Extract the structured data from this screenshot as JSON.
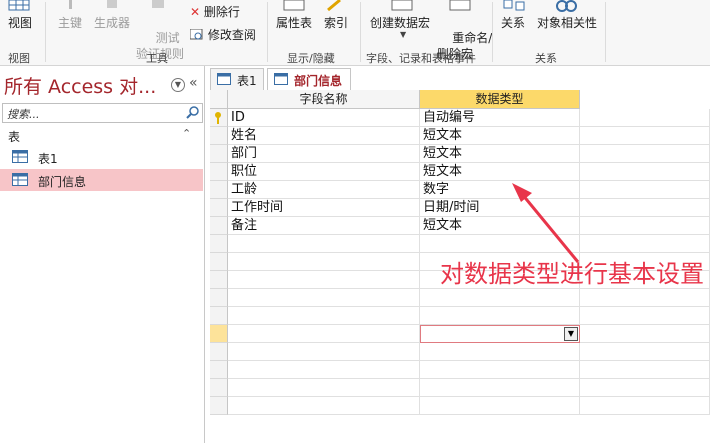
{
  "ribbon": {
    "view_label": "视图",
    "primary_key_label": "主键",
    "builder_label": "生成器",
    "test_rules_label": "测试\n验证规则",
    "delete_rows_label": "删除行",
    "modify_lookups_label": "修改查阅",
    "property_sheet_label": "属性表",
    "indexes_label": "索引",
    "create_macro_label": "创建数据宏",
    "rename_delete_macro_label": "重命名/\n删除宏",
    "relationships_label": "关系",
    "object_dependencies_label": "对象相关性",
    "groups": {
      "views": "视图",
      "tools": "工具",
      "show_hide": "显示/隐藏",
      "field_record_events": "字段、记录和表格事件",
      "relationships": "关系"
    }
  },
  "nav": {
    "title": "所有 Access 对...",
    "search_placeholder": "搜索...",
    "group_label": "表",
    "items": [
      {
        "label": "表1",
        "selected": false
      },
      {
        "label": "部门信息",
        "selected": true
      }
    ]
  },
  "tabs": [
    {
      "label": "表1",
      "active": false
    },
    {
      "label": "部门信息",
      "active": true
    }
  ],
  "grid": {
    "columns": [
      "字段名称",
      "数据类型"
    ],
    "rows": [
      {
        "field": "ID",
        "type": "自动编号",
        "primary_key": true
      },
      {
        "field": "姓名",
        "type": "短文本"
      },
      {
        "field": "部门",
        "type": "短文本"
      },
      {
        "field": "职位",
        "type": "短文本"
      },
      {
        "field": "工龄",
        "type": "数字"
      },
      {
        "field": "工作时间",
        "type": "日期/时间"
      },
      {
        "field": "备注",
        "type": "短文本"
      }
    ]
  },
  "annotation": "对数据类型进行基本设置",
  "colors": {
    "accent": "#a4262c",
    "selection": "#f7c5c8",
    "header_selected": "#fcd96a",
    "annotation": "#e8354a"
  }
}
